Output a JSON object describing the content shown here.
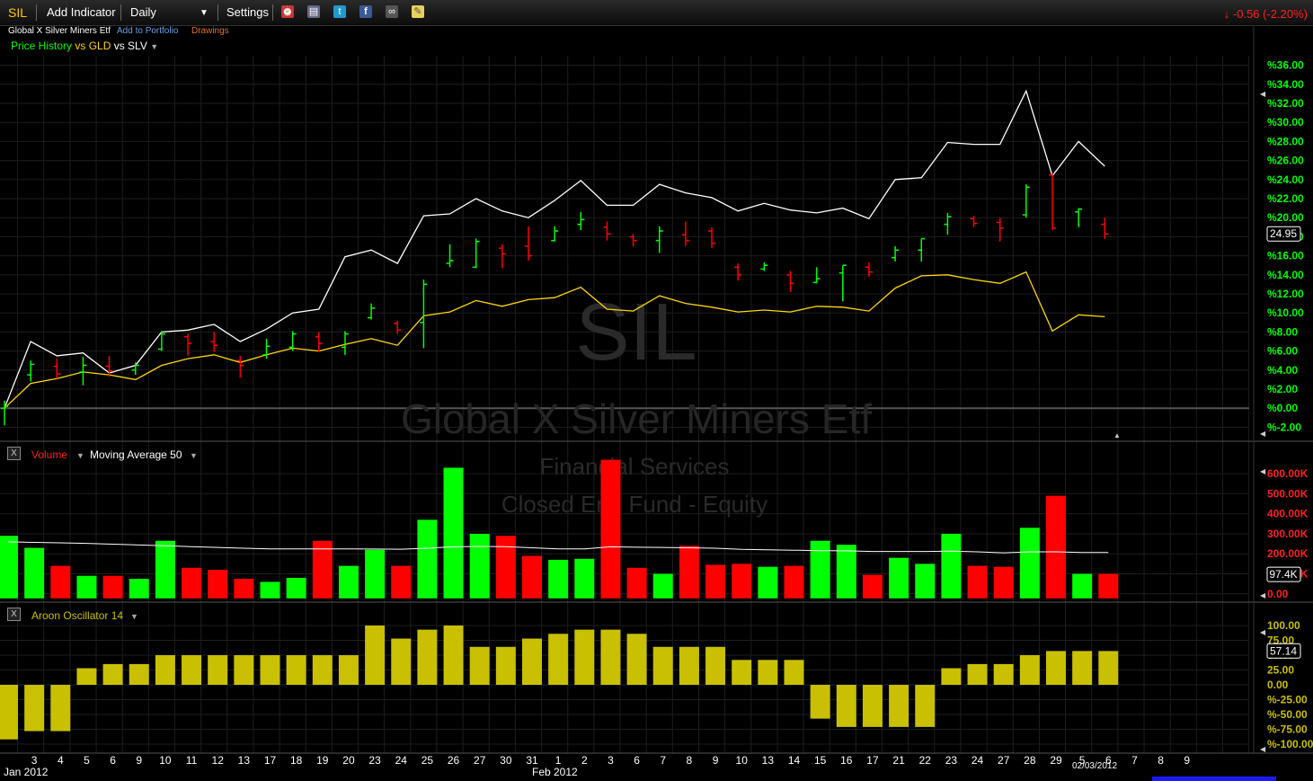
{
  "toolbar": {
    "symbol": "SIL",
    "add_indicator": "Add Indicator",
    "interval": "Daily",
    "settings": "Settings",
    "icons": [
      "alarm-clock-icon",
      "print-icon",
      "twitter-icon",
      "facebook-icon",
      "binoculars-icon",
      "note-icon"
    ],
    "change": "-0.56 (-2.20%)",
    "change_color": "#ff2020"
  },
  "subheader": {
    "name": "Global X Silver Miners Etf",
    "add_portfolio": "Add to Portfolio",
    "drawings": "Drawings",
    "price_history": "Price History",
    "vs_gld": "vs GLD",
    "vs_slv": "vs SLV"
  },
  "watermark": {
    "symbol": "SIL",
    "name": "Global X Silver Miners Etf",
    "sector": "Financial Services",
    "category": "Closed End Fund - Equity"
  },
  "panels": {
    "volume_label": "Volume",
    "ma_label": "Moving Average 50",
    "aroon_label": "Aroon Oscillator 14",
    "close_button": "X"
  },
  "colors": {
    "up": "#00ff00",
    "down": "#ff0000",
    "sil_line": "#ffffff",
    "gld_line": "#ffd700",
    "aroon": "#c8c000",
    "axis_label": "#00ff00",
    "volume_axis": "#ff2020",
    "grid": "#1e1e1e"
  },
  "chart_data": [
    {
      "type": "bar",
      "name": "price-history",
      "series": [
        {
          "name": "SIL",
          "style": "ohlc"
        },
        {
          "name": "GLD"
        },
        {
          "name": "SLV"
        }
      ],
      "ylim": [
        -3,
        37
      ],
      "yticks": [
        "%-2.00",
        "%0.00",
        "%2.00",
        "%4.00",
        "%6.00",
        "%8.00",
        "%10.00",
        "%12.00",
        "%14.00",
        "%16.00",
        "%18.00",
        "%20.00",
        "%22.00",
        "%24.00",
        "%26.00",
        "%28.00",
        "%30.00",
        "%32.00",
        "%34.00",
        "%36.00"
      ],
      "ytick_values": [
        -2,
        0,
        2,
        4,
        6,
        8,
        10,
        12,
        14,
        16,
        18,
        20,
        22,
        24,
        26,
        28,
        30,
        32,
        34,
        36
      ],
      "last_value_label": "24.95",
      "last_value_at": 18.3,
      "slv_pct": [
        0,
        7,
        5.5,
        5.8,
        3.7,
        4.5,
        8,
        8.2,
        8.8,
        7,
        8.3,
        10,
        10.4,
        15.9,
        16.6,
        15.2,
        20.2,
        20.4,
        22,
        20.7,
        20,
        21.8,
        23.9,
        21.3,
        21.3,
        23.5,
        22.6,
        22.1,
        20.7,
        21.5,
        20.8,
        20.5,
        21,
        19.9,
        24,
        24.2,
        27.9,
        27.7,
        27.7,
        33.3,
        24.4,
        28,
        25.4
      ],
      "gld_pct": [
        0,
        2.6,
        3.1,
        3.8,
        3.5,
        3,
        4.5,
        5.2,
        5.6,
        4.8,
        5.6,
        6.3,
        6,
        6.7,
        7.3,
        6.6,
        9.7,
        10.1,
        11.3,
        10.7,
        11.4,
        11.6,
        12.7,
        10.4,
        10.2,
        11.8,
        11,
        10.6,
        10.1,
        10.3,
        10.1,
        10.7,
        10.6,
        10.2,
        12.6,
        13.9,
        14,
        13.5,
        13.1,
        14.3,
        8.1,
        9.8,
        9.6
      ],
      "sil_ohlc": [
        {
          "o": 0,
          "h": 0.8,
          "l": -1.8,
          "c": 0.2,
          "up": true
        },
        {
          "o": 3.5,
          "h": 5,
          "l": 2.8,
          "c": 4.6,
          "up": true
        },
        {
          "o": 4.4,
          "h": 5.2,
          "l": 3.1,
          "c": 3.6,
          "up": false
        },
        {
          "o": 3.8,
          "h": 5.4,
          "l": 2.4,
          "c": 4.5,
          "up": true
        },
        {
          "o": 4.4,
          "h": 5.5,
          "l": 3.3,
          "c": 3.9,
          "up": false
        },
        {
          "o": 4,
          "h": 4.8,
          "l": 3.5,
          "c": 4.5,
          "up": true
        },
        {
          "o": 6.2,
          "h": 8.1,
          "l": 6,
          "c": 7.8,
          "up": true
        },
        {
          "o": 7.5,
          "h": 7.8,
          "l": 5.5,
          "c": 6.8,
          "up": false
        },
        {
          "o": 7,
          "h": 8,
          "l": 5.9,
          "c": 6.6,
          "up": false
        },
        {
          "o": 5,
          "h": 5.5,
          "l": 3.2,
          "c": 4.5,
          "up": false
        },
        {
          "o": 5.6,
          "h": 7.3,
          "l": 5.2,
          "c": 6.5,
          "up": true
        },
        {
          "o": 6.4,
          "h": 8.1,
          "l": 6,
          "c": 7.8,
          "up": true
        },
        {
          "o": 7.5,
          "h": 8,
          "l": 5.9,
          "c": 6.8,
          "up": false
        },
        {
          "o": 6.4,
          "h": 8.1,
          "l": 5.6,
          "c": 7.8,
          "up": true
        },
        {
          "o": 9.5,
          "h": 11,
          "l": 9.3,
          "c": 10.5,
          "up": true
        },
        {
          "o": 8.9,
          "h": 9.2,
          "l": 7.8,
          "c": 8.2,
          "up": false
        },
        {
          "o": 9,
          "h": 13.5,
          "l": 6.3,
          "c": 13,
          "up": true
        },
        {
          "o": 15.2,
          "h": 17.2,
          "l": 14.8,
          "c": 15.5,
          "up": true
        },
        {
          "o": 14.8,
          "h": 17.8,
          "l": 14.7,
          "c": 17.5,
          "up": true
        },
        {
          "o": 16.8,
          "h": 17.2,
          "l": 14.7,
          "c": 16.2,
          "up": false
        },
        {
          "o": 17,
          "h": 19.1,
          "l": 15.5,
          "c": 16,
          "up": false
        },
        {
          "o": 17.6,
          "h": 19.1,
          "l": 17.5,
          "c": 18.6,
          "up": true
        },
        {
          "o": 19.3,
          "h": 20.6,
          "l": 18.7,
          "c": 19.8,
          "up": true
        },
        {
          "o": 19,
          "h": 19.6,
          "l": 17.6,
          "c": 18.3,
          "up": false
        },
        {
          "o": 18,
          "h": 18.3,
          "l": 17,
          "c": 17.6,
          "up": false
        },
        {
          "o": 17.6,
          "h": 19.1,
          "l": 16.3,
          "c": 18.6,
          "up": true
        },
        {
          "o": 18.2,
          "h": 19.6,
          "l": 17,
          "c": 17.6,
          "up": false
        },
        {
          "o": 18.6,
          "h": 19,
          "l": 16.8,
          "c": 17.3,
          "up": false
        },
        {
          "o": 14.8,
          "h": 15.2,
          "l": 13.4,
          "c": 14,
          "up": false
        },
        {
          "o": 14.6,
          "h": 15.3,
          "l": 14.4,
          "c": 15,
          "up": true
        },
        {
          "o": 14,
          "h": 14.4,
          "l": 12.2,
          "c": 13.1,
          "up": false
        },
        {
          "o": 13.2,
          "h": 14.8,
          "l": 13.1,
          "c": 13.6,
          "up": true
        },
        {
          "o": 14.2,
          "h": 15,
          "l": 11.2,
          "c": 15,
          "up": true
        },
        {
          "o": 14.8,
          "h": 15.3,
          "l": 13.8,
          "c": 14.3,
          "up": false
        },
        {
          "o": 15.8,
          "h": 17,
          "l": 15.4,
          "c": 16.6,
          "up": true
        },
        {
          "o": 16.6,
          "h": 17.8,
          "l": 15.4,
          "c": 17.8,
          "up": true
        },
        {
          "o": 19.3,
          "h": 20.5,
          "l": 18.2,
          "c": 20.1,
          "up": true
        },
        {
          "o": 19.9,
          "h": 20.2,
          "l": 19,
          "c": 19.4,
          "up": false
        },
        {
          "o": 19.5,
          "h": 20,
          "l": 17.5,
          "c": 18.9,
          "up": false
        },
        {
          "o": 20.3,
          "h": 23.5,
          "l": 20,
          "c": 23.2,
          "up": true
        },
        {
          "o": 24.5,
          "h": 24.6,
          "l": 18.7,
          "c": 18.9,
          "up": false
        },
        {
          "o": 20.6,
          "h": 21,
          "l": 19,
          "c": 20.9,
          "up": true
        },
        {
          "o": 19.3,
          "h": 20,
          "l": 17.8,
          "c": 18.3,
          "up": false
        }
      ],
      "x_day_labels": [
        "3",
        "4",
        "5",
        "6",
        "9",
        "10",
        "11",
        "12",
        "13",
        "17",
        "18",
        "19",
        "20",
        "23",
        "24",
        "25",
        "26",
        "27",
        "30",
        "31",
        "1",
        "2",
        "3",
        "6",
        "7",
        "8",
        "9",
        "10",
        "13",
        "14",
        "15",
        "16",
        "17",
        "21",
        "22",
        "23",
        "24",
        "27",
        "28",
        "29",
        "5",
        "6",
        "7",
        "8",
        "9"
      ],
      "x_month_labels": [
        "Jan 2012",
        "Feb 2012"
      ],
      "x_marker_label": "02/03/2012"
    },
    {
      "type": "bar",
      "name": "volume",
      "values_k": [
        290,
        230,
        140,
        90,
        90,
        75,
        265,
        130,
        120,
        75,
        60,
        80,
        265,
        140,
        220,
        140,
        370,
        630,
        300,
        290,
        190,
        170,
        175,
        670,
        130,
        100,
        240,
        145,
        150,
        135,
        140,
        265,
        245,
        95,
        180,
        150,
        300,
        140,
        135,
        330,
        490,
        100,
        100
      ],
      "colors": [
        "up",
        "up",
        "down",
        "up",
        "down",
        "up",
        "up",
        "down",
        "down",
        "down",
        "up",
        "up",
        "down",
        "up",
        "up",
        "down",
        "up",
        "up",
        "up",
        "down",
        "down",
        "up",
        "up",
        "down",
        "down",
        "up",
        "down",
        "down",
        "down",
        "up",
        "down",
        "up",
        "up",
        "down",
        "up",
        "up",
        "up",
        "down",
        "down",
        "up",
        "down",
        "up",
        "down"
      ],
      "moving_average_k": [
        260,
        257,
        255,
        252,
        248,
        244,
        240,
        236,
        232,
        228,
        225,
        225,
        225,
        225,
        224,
        223,
        228,
        235,
        237,
        236,
        230,
        225,
        225,
        235,
        233,
        232,
        230,
        228,
        222,
        220,
        218,
        216,
        215,
        212,
        212,
        212,
        213,
        210,
        205,
        210,
        210,
        207,
        207
      ],
      "ylim": [
        -10,
        650
      ],
      "yticks": [
        "0.00",
        "100.00K",
        "200.00K",
        "300.00K",
        "400.00K",
        "500.00K",
        "600.00K"
      ],
      "ytick_values": [
        0,
        100,
        200,
        300,
        400,
        500,
        600
      ],
      "last_value_label": "97.4K",
      "last_value_at": 97.4
    },
    {
      "type": "bar",
      "name": "aroon-oscillator",
      "values": [
        -92,
        -78,
        -78,
        28,
        35,
        35,
        50,
        50,
        50,
        50,
        50,
        50,
        50,
        50,
        100,
        78,
        93,
        100,
        64,
        64,
        78,
        86,
        93,
        93,
        86,
        64,
        64,
        64,
        42,
        42,
        42,
        -57,
        -71,
        -71,
        -71,
        -71,
        28,
        35,
        35,
        50,
        57,
        57,
        57
      ],
      "ylim": [
        -100,
        100
      ],
      "yticks": [
        "%-100.00",
        "%-75.00",
        "%-50.00",
        "%-25.00",
        "0.00",
        "25.00",
        "50.00",
        "75.00",
        "100.00"
      ],
      "ytick_values": [
        -100,
        -75,
        -50,
        -25,
        0,
        25,
        50,
        75,
        100
      ],
      "last_value_label": "57.14",
      "last_value_at": 57.14
    }
  ]
}
